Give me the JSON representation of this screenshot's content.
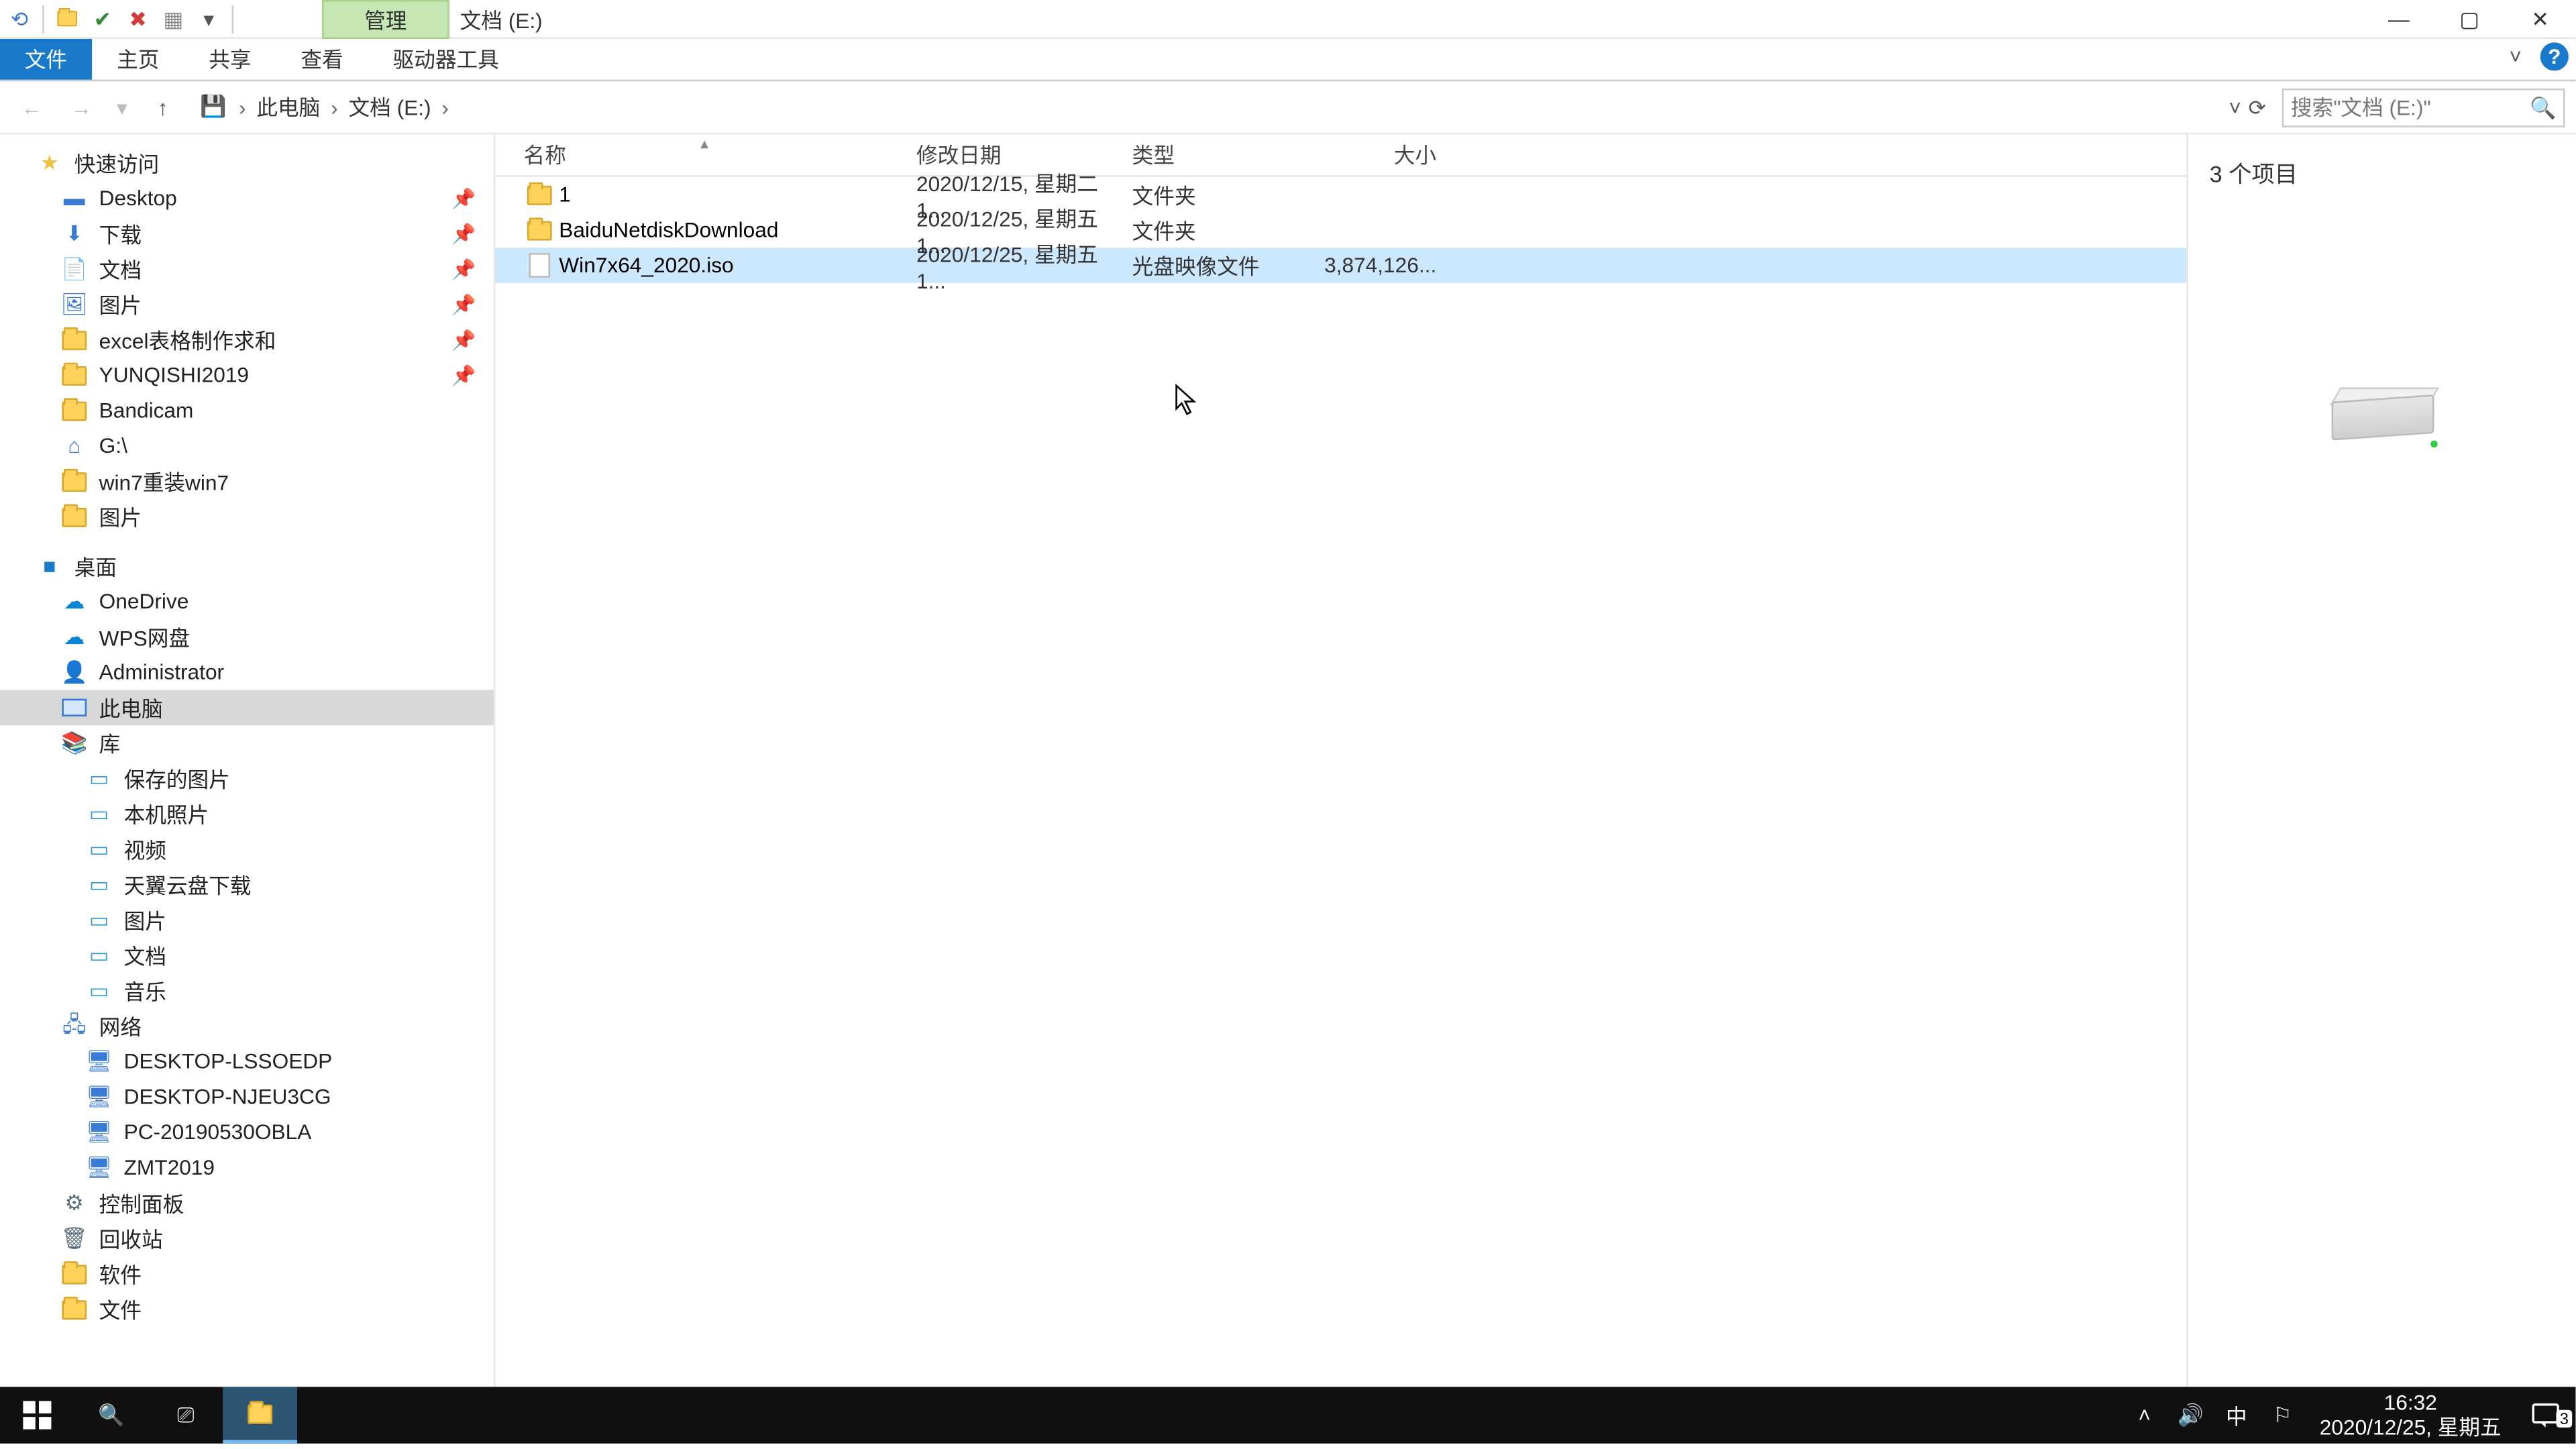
{
  "title": "文档 (E:)",
  "contextual_tab": "管理",
  "ribbon": {
    "file": "文件",
    "home": "主页",
    "share": "共享",
    "view": "查看",
    "drive": "驱动器工具"
  },
  "breadcrumb": {
    "root": "此电脑",
    "current": "文档 (E:)"
  },
  "search_placeholder": "搜索\"文档 (E:)\"",
  "columns": {
    "name": "名称",
    "date": "修改日期",
    "type": "类型",
    "size": "大小"
  },
  "rows": [
    {
      "icon": "folder",
      "name": "1",
      "date": "2020/12/15, 星期二 1...",
      "type": "文件夹",
      "size": ""
    },
    {
      "icon": "folder",
      "name": "BaiduNetdiskDownload",
      "date": "2020/12/25, 星期五 1...",
      "type": "文件夹",
      "size": ""
    },
    {
      "icon": "file",
      "name": "Win7x64_2020.iso",
      "date": "2020/12/25, 星期五 1...",
      "type": "光盘映像文件",
      "size": "3,874,126..."
    }
  ],
  "preview_title": "3 个项目",
  "status_text": "3 个项目",
  "tree": {
    "quick_access": "快速访问",
    "qa_items": [
      {
        "label": "Desktop",
        "icon": "desktop",
        "pinned": true
      },
      {
        "label": "下载",
        "icon": "downloads",
        "pinned": true
      },
      {
        "label": "文档",
        "icon": "docs",
        "pinned": true
      },
      {
        "label": "图片",
        "icon": "pics",
        "pinned": true
      },
      {
        "label": "excel表格制作求和",
        "icon": "folder",
        "pinned": true
      },
      {
        "label": "YUNQISHI2019",
        "icon": "folder",
        "pinned": true
      },
      {
        "label": "Bandicam",
        "icon": "folder",
        "pinned": false
      },
      {
        "label": "G:\\",
        "icon": "drive",
        "pinned": false
      },
      {
        "label": "win7重装win7",
        "icon": "folder",
        "pinned": false
      },
      {
        "label": "图片",
        "icon": "folder",
        "pinned": false
      }
    ],
    "desktop": "桌面",
    "desktop_items": [
      {
        "label": "OneDrive",
        "icon": "onedrive"
      },
      {
        "label": "WPS网盘",
        "icon": "wps"
      },
      {
        "label": "Administrator",
        "icon": "user"
      },
      {
        "label": "此电脑",
        "icon": "thispc",
        "selected": true
      },
      {
        "label": "库",
        "icon": "lib"
      }
    ],
    "lib_items": [
      {
        "label": "保存的图片"
      },
      {
        "label": "本机照片"
      },
      {
        "label": "视频"
      },
      {
        "label": "天翼云盘下载"
      },
      {
        "label": "图片"
      },
      {
        "label": "文档"
      },
      {
        "label": "音乐"
      }
    ],
    "network": "网络",
    "net_items": [
      {
        "label": "DESKTOP-LSSOEDP"
      },
      {
        "label": "DESKTOP-NJEU3CG"
      },
      {
        "label": "PC-20190530OBLA"
      },
      {
        "label": "ZMT2019"
      }
    ],
    "control_panel": "控制面板",
    "recycle": "回收站",
    "soft": "软件",
    "wenjian": "文件"
  },
  "taskbar": {
    "time": "16:32",
    "date": "2020/12/25, 星期五",
    "ime": "中",
    "notif_count": "3"
  }
}
